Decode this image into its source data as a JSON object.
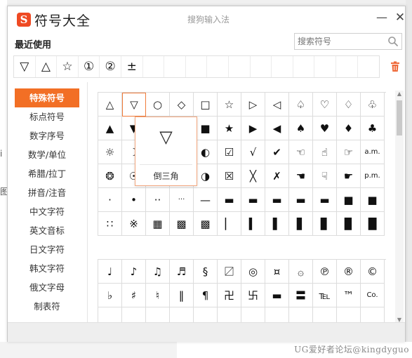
{
  "app": {
    "logo_letter": "S",
    "title": "符号大全",
    "ime_title": "搜狗输入法",
    "min_glyph": "—",
    "close_glyph": "✕"
  },
  "recent": {
    "label": "最近使用",
    "items": [
      "▽",
      "△",
      "☆",
      "①",
      "②",
      "±",
      "",
      "",
      "",
      "",
      "",
      "",
      "",
      "",
      "",
      "",
      ""
    ]
  },
  "search": {
    "placeholder": "搜索符号"
  },
  "categories": [
    "特殊符号",
    "标点符号",
    "数字序号",
    "数学/单位",
    "希腊/拉丁",
    "拼音/注音",
    "中文字符",
    "英文音标",
    "日文字符",
    "韩文字符",
    "俄文字母",
    "制表符"
  ],
  "active_category_index": 0,
  "symbols_group1": [
    "△",
    "▽",
    "○",
    "◇",
    "□",
    "☆",
    "▷",
    "◁",
    "♤",
    "♡",
    "♢",
    "♧",
    "▲",
    "▼",
    "●",
    "◆",
    "■",
    "★",
    "▶",
    "◀",
    "♠",
    "♥",
    "♦",
    "♣",
    "☼",
    "☽",
    "♀",
    "☺",
    "◐",
    "☑",
    "√",
    "✔",
    "☜",
    "☝",
    "☞",
    "a.m.",
    "❂",
    "☉",
    "♂",
    "☻",
    "◑",
    "☒",
    "╳",
    "✗",
    "☚",
    "☟",
    "☛",
    "p.m.",
    "·",
    "•",
    "··",
    "···",
    "—",
    "▬",
    "▬",
    "▬",
    "▬",
    "▬",
    "■",
    "■",
    "∷",
    "※",
    "▦",
    "▩",
    "▩",
    "▏",
    "▍",
    "▌",
    "▋",
    "▊",
    "▉",
    "█"
  ],
  "symbols_group2": [
    "♩",
    "♪",
    "♫",
    "♬",
    "§",
    "〼",
    "◎",
    "¤",
    "۞",
    "℗",
    "®",
    "©",
    "♭",
    "♯",
    "♮",
    "‖",
    "¶",
    "卍",
    "卐",
    "▬",
    "〓",
    "℡",
    "™",
    "Co.",
    "",
    "",
    "",
    "",
    "",
    "",
    "",
    "",
    "",
    "",
    "",
    ""
  ],
  "popup": {
    "symbol": "▽",
    "name": "倒三角"
  },
  "background": {
    "frag_a": "i",
    "frag_b": "图",
    "watermark": "UG爱好者论坛@kingdyguo"
  },
  "colors": {
    "accent": "#f26f25",
    "logo": "#ef4a23",
    "highlight_border": "#f07b3a"
  }
}
